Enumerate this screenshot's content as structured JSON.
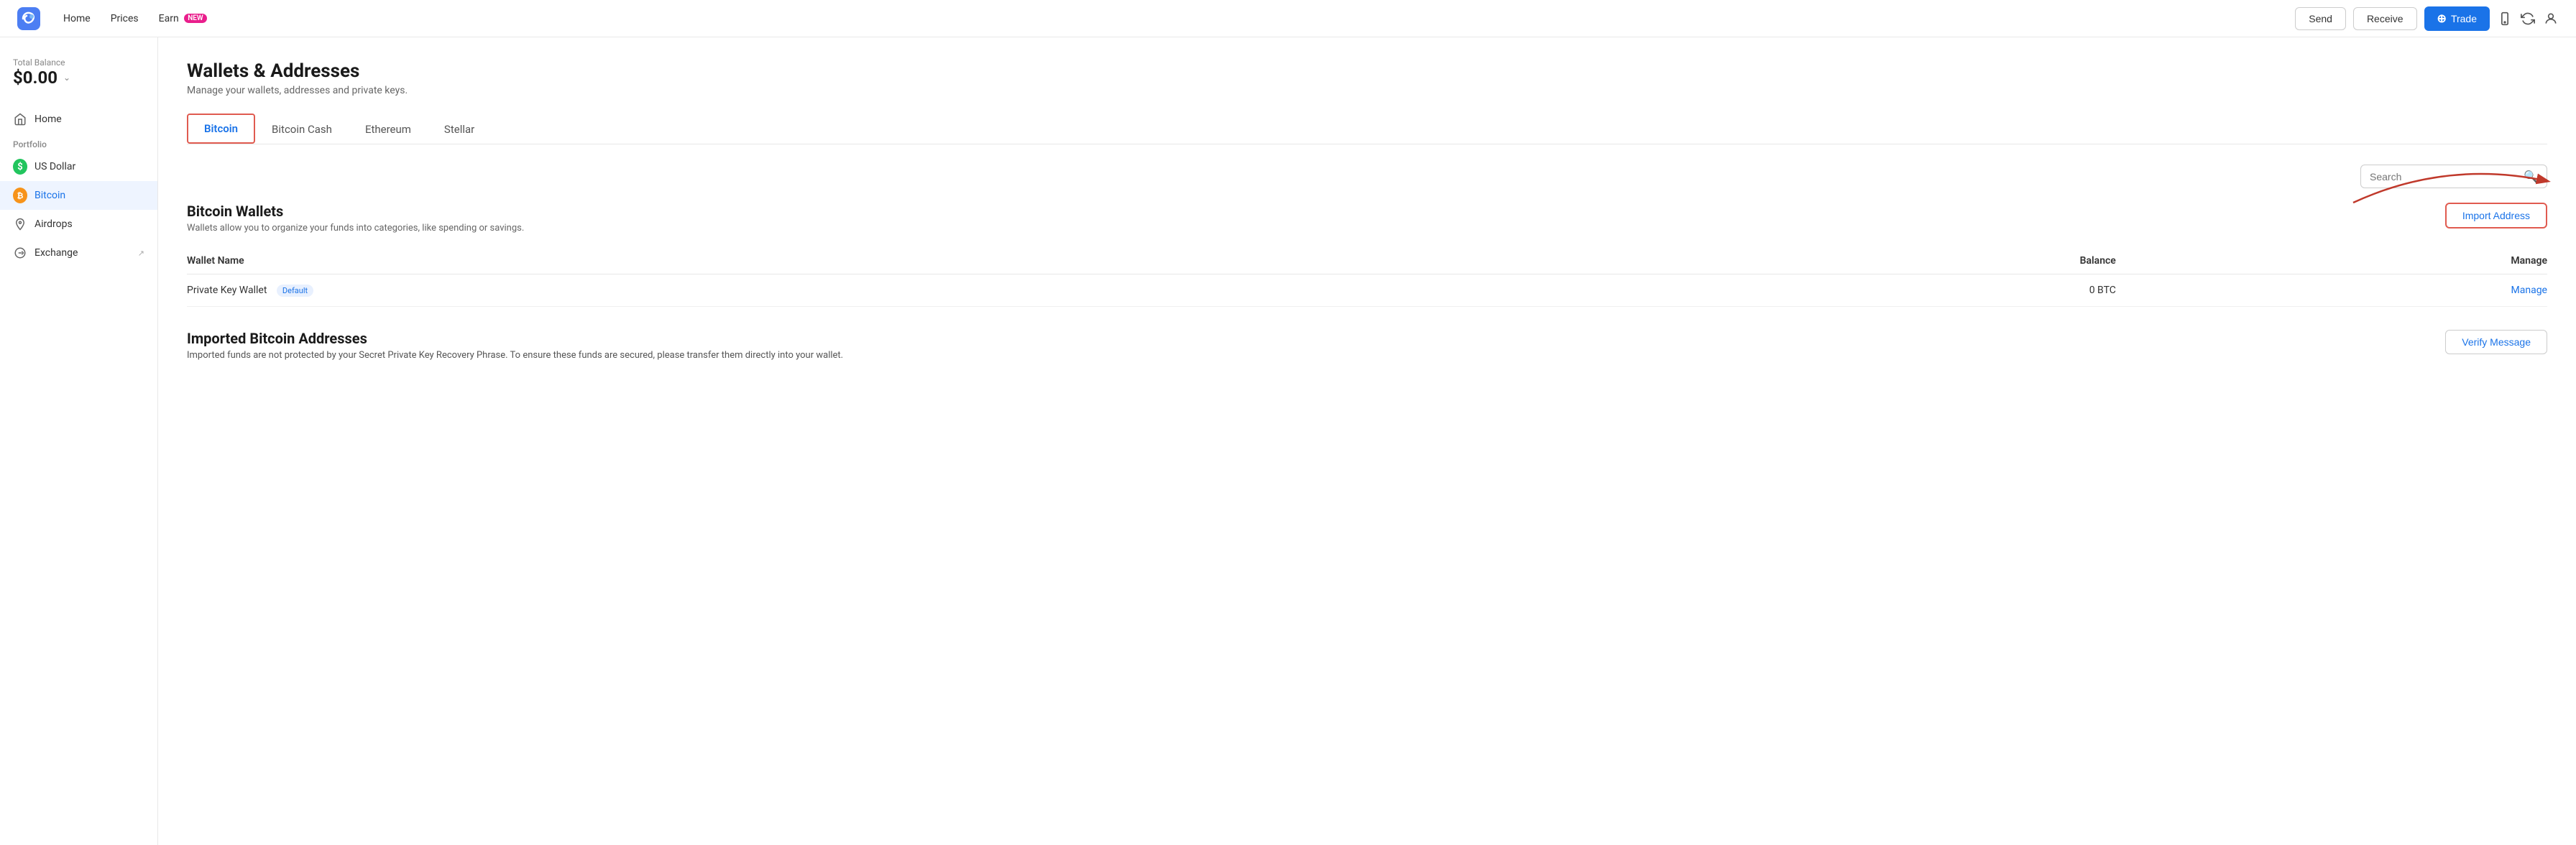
{
  "topnav": {
    "home_label": "Home",
    "prices_label": "Prices",
    "earn_label": "Earn",
    "earn_badge": "NEW",
    "send_label": "Send",
    "receive_label": "Receive",
    "trade_label": "Trade"
  },
  "sidebar": {
    "balance_label": "Total Balance",
    "balance_amount": "$0.00",
    "home_label": "Home",
    "portfolio_label": "Portfolio",
    "us_dollar_label": "US Dollar",
    "bitcoin_label": "Bitcoin",
    "airdrops_label": "Airdrops",
    "exchange_label": "Exchange"
  },
  "main": {
    "page_title": "Wallets & Addresses",
    "page_subtitle": "Manage your wallets, addresses and private keys.",
    "tabs": [
      {
        "label": "Bitcoin",
        "active": true
      },
      {
        "label": "Bitcoin Cash",
        "active": false
      },
      {
        "label": "Ethereum",
        "active": false
      },
      {
        "label": "Stellar",
        "active": false
      }
    ],
    "search_placeholder": "Search",
    "section_title": "Bitcoin Wallets",
    "section_desc": "Wallets allow you to organize your funds into categories, like spending or savings.",
    "import_button": "Import Address",
    "table": {
      "col_wallet_name": "Wallet Name",
      "col_balance": "Balance",
      "col_manage": "Manage",
      "rows": [
        {
          "wallet_name": "Private Key Wallet",
          "badge": "Default",
          "balance": "0 BTC",
          "manage_link": "Manage"
        }
      ]
    },
    "imported_title": "Imported Bitcoin Addresses",
    "imported_desc": "Imported funds are not protected by your Secret Private Key Recovery Phrase. To ensure these funds are secured, please transfer them directly into your wallet.",
    "verify_button": "Verify Message"
  }
}
